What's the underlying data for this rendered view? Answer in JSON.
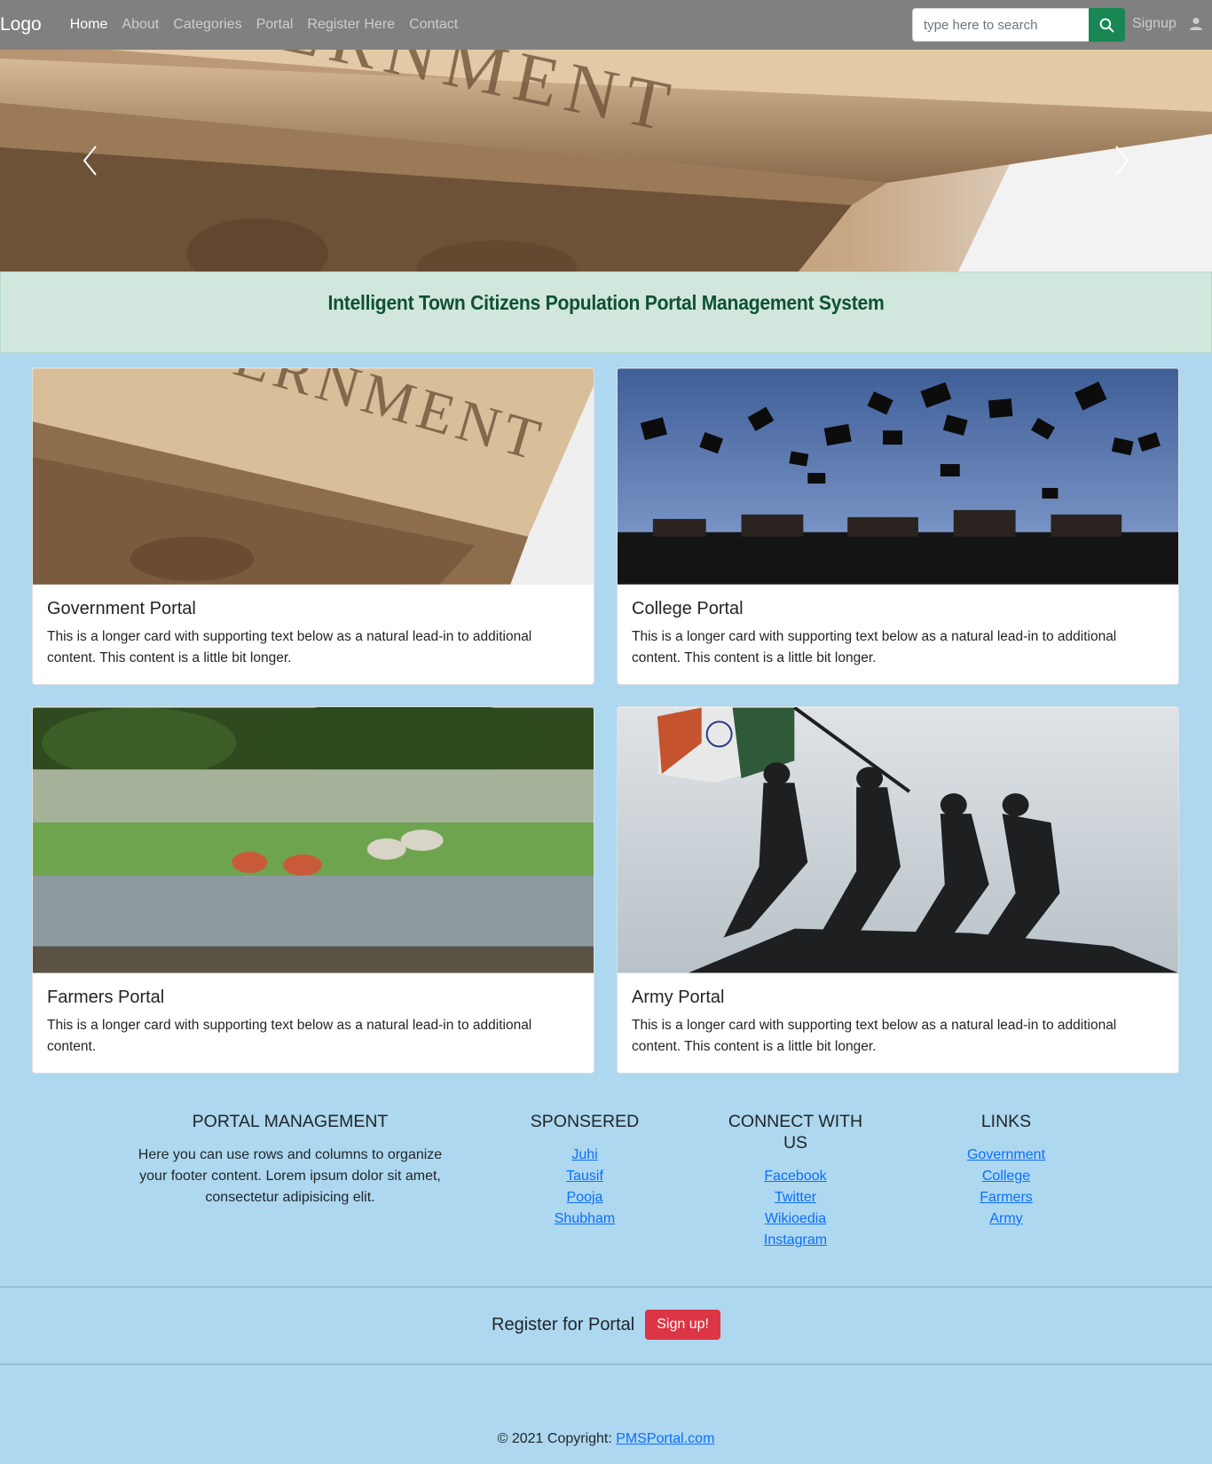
{
  "navbar": {
    "brand": "Logo",
    "links": [
      "Home",
      "About",
      "Categories",
      "Portal",
      "Register Here",
      "Contact"
    ],
    "search_placeholder": "type here to search",
    "signup": "Signup"
  },
  "hero": {
    "image": "government building engraving",
    "engraving_text": "GOVERNMENT"
  },
  "banner": {
    "title": "Intelligent Town Citizens Population Portal Management System"
  },
  "cards": [
    {
      "title": "Government Portal",
      "text": "This is a longer card with supporting text below as a natural lead-in to additional content. This content is a little bit longer.",
      "image": "government building"
    },
    {
      "title": "College Portal",
      "text": "This is a longer card with supporting text below as a natural lead-in to additional content. This content is a little bit longer.",
      "image": "graduation caps thrown"
    },
    {
      "title": "Farmers Portal",
      "text": "This is a longer card with supporting text below as a natural lead-in to additional content.",
      "image": "farmers planting rice"
    },
    {
      "title": "Army Portal",
      "text": "This is a longer card with supporting text below as a natural lead-in to additional content. This content is a little bit longer.",
      "image": "soldiers raising flag statue"
    }
  ],
  "footer": {
    "portal": {
      "heading": "PORTAL MANAGEMENT",
      "text": "Here you can use rows and columns to organize your footer content. Lorem ipsum dolor sit amet, consectetur adipisicing elit."
    },
    "sponsered": {
      "heading": "SPONSERED",
      "links": [
        "Juhi",
        "Tausif",
        "Pooja",
        "Shubham"
      ]
    },
    "connect": {
      "heading": "CONNECT WITH US",
      "links": [
        "Facebook",
        "Twitter",
        "Wikioedia",
        "Instagram"
      ]
    },
    "links": {
      "heading": "LINKS",
      "links": [
        "Government",
        "College",
        "Farmers",
        "Army"
      ]
    },
    "register_text": "Register for Portal",
    "signup_button": "Sign up!",
    "copyright_prefix": "© 2021 Copyright: ",
    "copyright_link": "PMSPortal.com"
  },
  "colors": {
    "navbar": "#808080",
    "page_bg": "#add8ef",
    "banner_bg": "#d1e7dd",
    "banner_text": "#0f5132",
    "search_button": "#198754",
    "signup_button": "#dc3545",
    "link": "#0d6efd"
  }
}
